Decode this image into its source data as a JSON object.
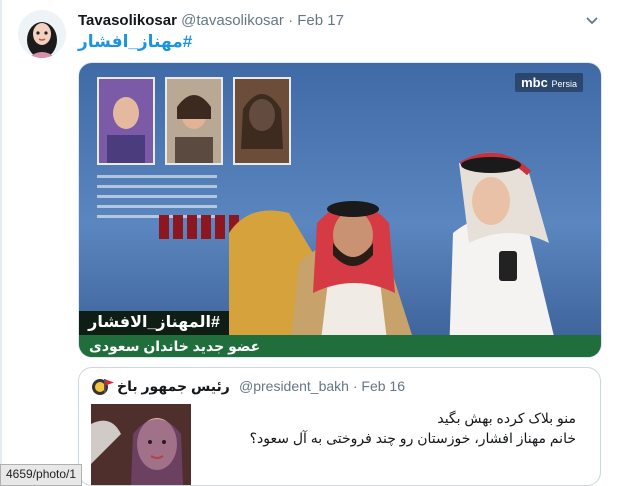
{
  "tweet": {
    "display_name": "Tavasolikosar",
    "handle": "@tavasolikosar",
    "separator": "·",
    "date": "Feb 17",
    "hashtag": "#مهناز_افشار",
    "menu_icon": "chevron-down-icon",
    "media": {
      "network_logo": "mbc",
      "network_logo_sub": "Persia",
      "caption": "#المهناز_الافشار",
      "caption_sub": "عضو جدید خاندان سعودی"
    }
  },
  "quoted_tweet": {
    "avatar_badge": "red-flag-icon",
    "display_name": "رئیس جمهور باخ",
    "handle": "@president_bakh",
    "separator": "·",
    "date": "Feb 16",
    "text_line1": "منو بلاک کرده بهش بگید",
    "text_line2": "خانم مهناز افشار، خوزستان  رو چند فروختی به آل سعود؟"
  },
  "status_bar": {
    "link_text": "4659/photo/1"
  }
}
